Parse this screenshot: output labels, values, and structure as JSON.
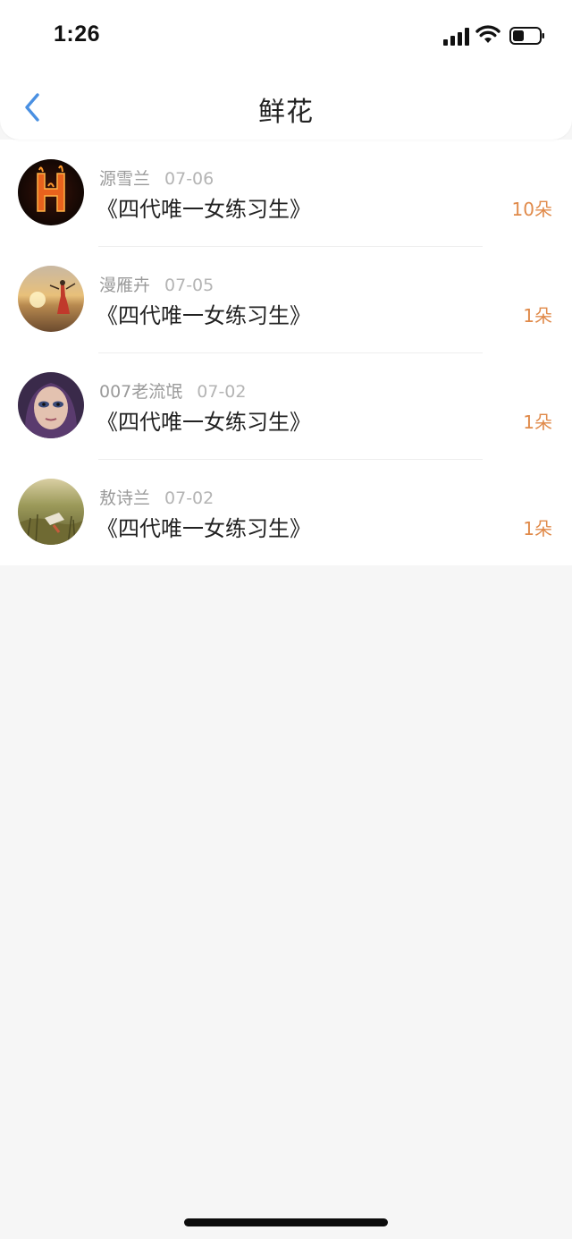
{
  "status_bar": {
    "time": "1:26",
    "icons": [
      "signal-icon",
      "wifi-icon",
      "battery-icon"
    ]
  },
  "nav": {
    "title": "鲜花",
    "back_icon": "chevron-left-icon",
    "accent_color": "#4a90e2"
  },
  "colors": {
    "count_color": "#e08a4a",
    "background": "#f6f6f6"
  },
  "items": [
    {
      "user": "源雪兰",
      "date": "07-06",
      "book": "《四代唯一女练习生》",
      "count": "10朵",
      "avatar": "fire-letter-avatar"
    },
    {
      "user": "漫雁卉",
      "date": "07-05",
      "book": "《四代唯一女练习生》",
      "count": "1朵",
      "avatar": "beach-sunset-avatar"
    },
    {
      "user": "007老流氓",
      "date": "07-02",
      "book": "《四代唯一女练习生》",
      "count": "1朵",
      "avatar": "portrait-avatar"
    },
    {
      "user": "敖诗兰",
      "date": "07-02",
      "book": "《四代唯一女练习生》",
      "count": "1朵",
      "avatar": "meadow-avatar"
    }
  ]
}
